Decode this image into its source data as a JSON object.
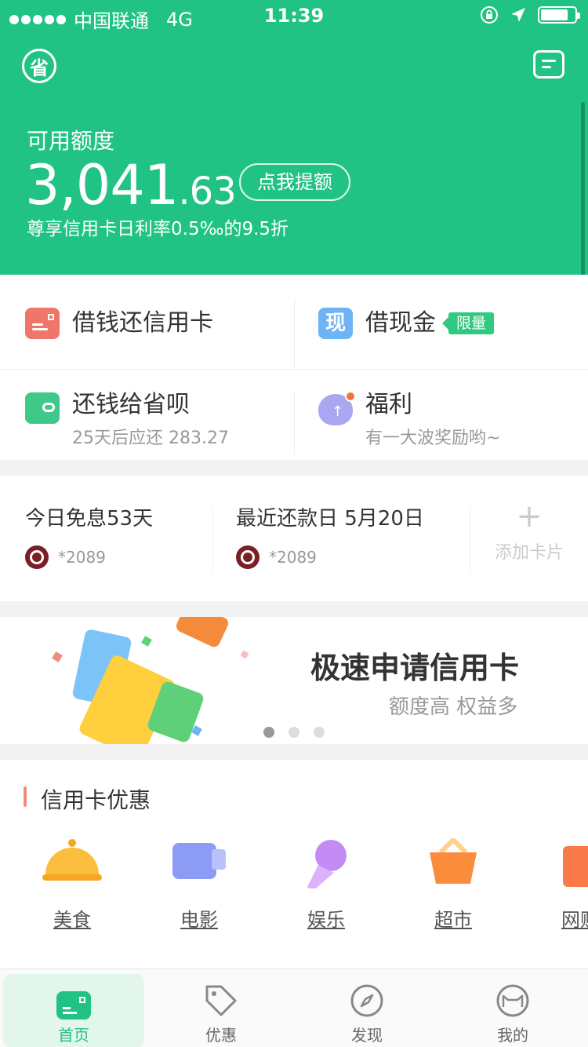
{
  "status_bar": {
    "carrier": "中国联通",
    "network": "4G",
    "time": "11:39"
  },
  "nav": {
    "logo_glyph": "省",
    "message_icon": "message-icon"
  },
  "hero": {
    "label": "可用额度",
    "amount_integer": "3,041",
    "amount_decimal": ".63",
    "raise_button": "点我提额",
    "rate_text": "尊享信用卡日利率0.5‰的9.5折"
  },
  "services": {
    "borrow_repay_card": "借钱还信用卡",
    "cash_loan": "借现金",
    "cash_glyph": "现",
    "limited_tag": "限量",
    "repay": {
      "title": "还钱给省呗",
      "subtitle": "25天后应还 283.27"
    },
    "welfare": {
      "title": "福利",
      "subtitle": "有一大波奖励哟~"
    }
  },
  "cards": {
    "free_interest": "今日免息53天",
    "recent_repay": "最近还款日 5月20日",
    "card_no_1": "*2089",
    "card_no_2": "*2089",
    "add_plus": "+",
    "add_label": "添加卡片"
  },
  "banner": {
    "title": "极速申请信用卡",
    "subtitle": "额度高 权益多",
    "slides": 3,
    "active_slide": 1
  },
  "deals": {
    "title": "信用卡优惠",
    "items": [
      {
        "label": "美食"
      },
      {
        "label": "电影"
      },
      {
        "label": "娱乐"
      },
      {
        "label": "超市"
      },
      {
        "label": "网购"
      }
    ]
  },
  "tabs": [
    {
      "label": "首页",
      "icon": "home-icon",
      "active": true
    },
    {
      "label": "优惠",
      "icon": "tag-icon",
      "active": false
    },
    {
      "label": "发现",
      "icon": "compass-icon",
      "active": false
    },
    {
      "label": "我的",
      "icon": "profile-cat-icon",
      "active": false
    }
  ],
  "colors": {
    "brand_green": "#21c384",
    "tag_green": "#2fc97f",
    "deal_accent": "#f28b7a"
  }
}
